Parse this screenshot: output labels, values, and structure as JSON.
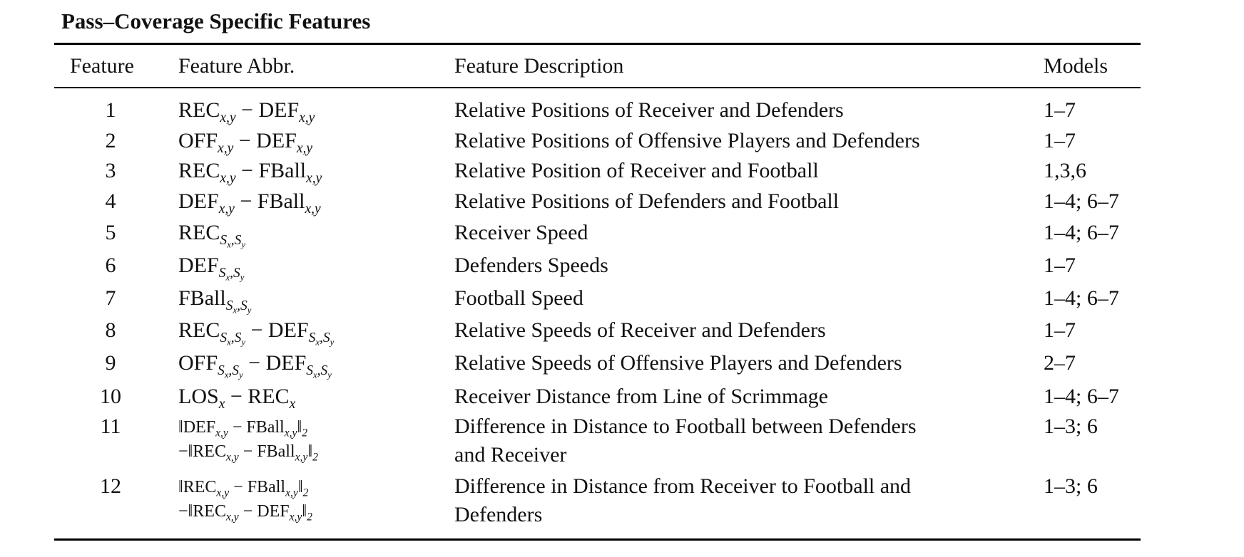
{
  "title": "Pass–Coverage Specific Features",
  "headers": {
    "feature": "Feature",
    "abbr": "Feature Abbr.",
    "description": "Feature Description",
    "models": "Models"
  },
  "rows": [
    {
      "num": "1",
      "desc": "Relative Positions of Receiver and Defenders",
      "models": "1–7"
    },
    {
      "num": "2",
      "desc": "Relative Positions of Offensive Players and Defenders",
      "models": "1–7"
    },
    {
      "num": "3",
      "desc": "Relative Position of Receiver and Football",
      "models": "1,3,6"
    },
    {
      "num": "4",
      "desc": "Relative Positions of Defenders and Football",
      "models": "1–4; 6–7"
    },
    {
      "num": "5",
      "desc": "Receiver Speed",
      "models": "1–4; 6–7"
    },
    {
      "num": "6",
      "desc": "Defenders Speeds",
      "models": "1–7"
    },
    {
      "num": "7",
      "desc": "Football Speed",
      "models": "1–4; 6–7"
    },
    {
      "num": "8",
      "desc": "Relative Speeds of Receiver and Defenders",
      "models": "1–7"
    },
    {
      "num": "9",
      "desc": "Relative Speeds of Offensive Players and Defenders",
      "models": "2–7"
    },
    {
      "num": "10",
      "desc": "Receiver Distance from Line of Scrimmage",
      "models": "1–4; 6–7"
    },
    {
      "num": "11",
      "desc_line1": "Difference in Distance to Football between Defenders",
      "desc_line2": "and Receiver",
      "models": "1–3; 6"
    },
    {
      "num": "12",
      "desc_line1": "Difference in Distance from Receiver to Football and",
      "desc_line2": "Defenders",
      "models": "1–3; 6"
    }
  ]
}
